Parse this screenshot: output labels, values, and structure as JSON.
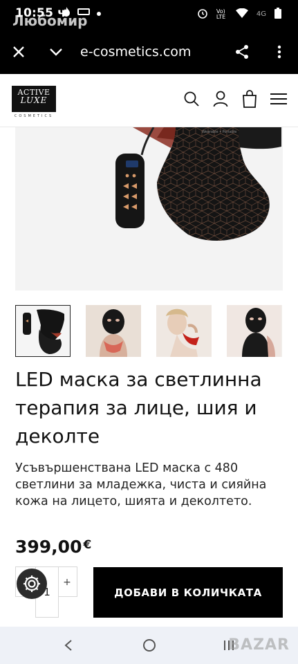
{
  "status_bar": {
    "time": "10:55 ч",
    "signal_label": "4G",
    "volte_label": "Vo) LTE"
  },
  "browser": {
    "page_owner": "Любомир",
    "url": "e-cosmetics.com"
  },
  "site": {
    "logo_line1": "ACTIVE",
    "logo_line2": "LUXE",
    "logo_sub": "COSMETICS"
  },
  "product": {
    "title": "LED маска за светлинна терапия за лице, шия и деколте",
    "description": "Усъвършенствана LED маска с 480 светлини за младежка, чиста и сияйна кожа на лицето, шията и деколтето.",
    "price": "399,00",
    "currency": "€",
    "quantity": "1",
    "qty_plus": "+",
    "add_to_cart": "ДОБАВИ В КОЛИЧКАТА"
  },
  "watermark": "BAZAR",
  "colors": {
    "accent": "#000000",
    "nav_bg": "#eef1f7"
  }
}
